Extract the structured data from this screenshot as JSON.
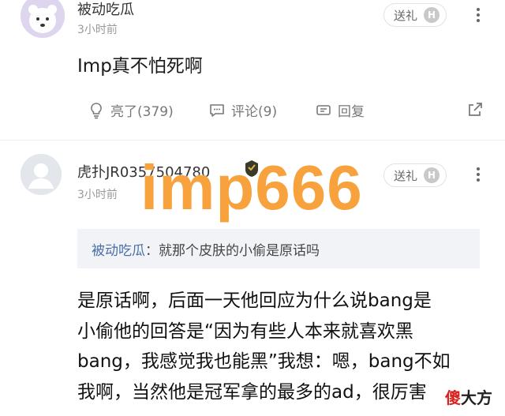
{
  "comment1": {
    "username": "被动吃瓜",
    "time": "3小时前",
    "gift_label": "送礼",
    "badge": "H",
    "content": "Imp真不怕死啊",
    "actions": {
      "like": "亮了(379)",
      "comment": "评论(9)",
      "reply": "回复"
    }
  },
  "comment2": {
    "username": "虎扑JR0357504780",
    "time": "3小时前",
    "gift_label": "送礼",
    "badge": "H",
    "quote": {
      "name": "被动吃瓜",
      "sep": "：",
      "text": "就那个皮肤的小偷是原话吗"
    },
    "reply_lines": [
      "是原话啊，后面一天他回应为什么说bang是",
      "小偷他的回答是“因为有些人本来就喜欢黑",
      "bang，我感觉我也能黑”我想：嗯，bang不如",
      "我啊，当然他是冠军拿的最多的ad，很厉害"
    ]
  },
  "watermarks": {
    "center": "imp666",
    "corner_red": "傻",
    "corner_black": "大方"
  },
  "colors": {
    "watermark": "#f7a23c",
    "quote_name": "#4a6fa8",
    "quote_bg": "#f2f3f6"
  }
}
